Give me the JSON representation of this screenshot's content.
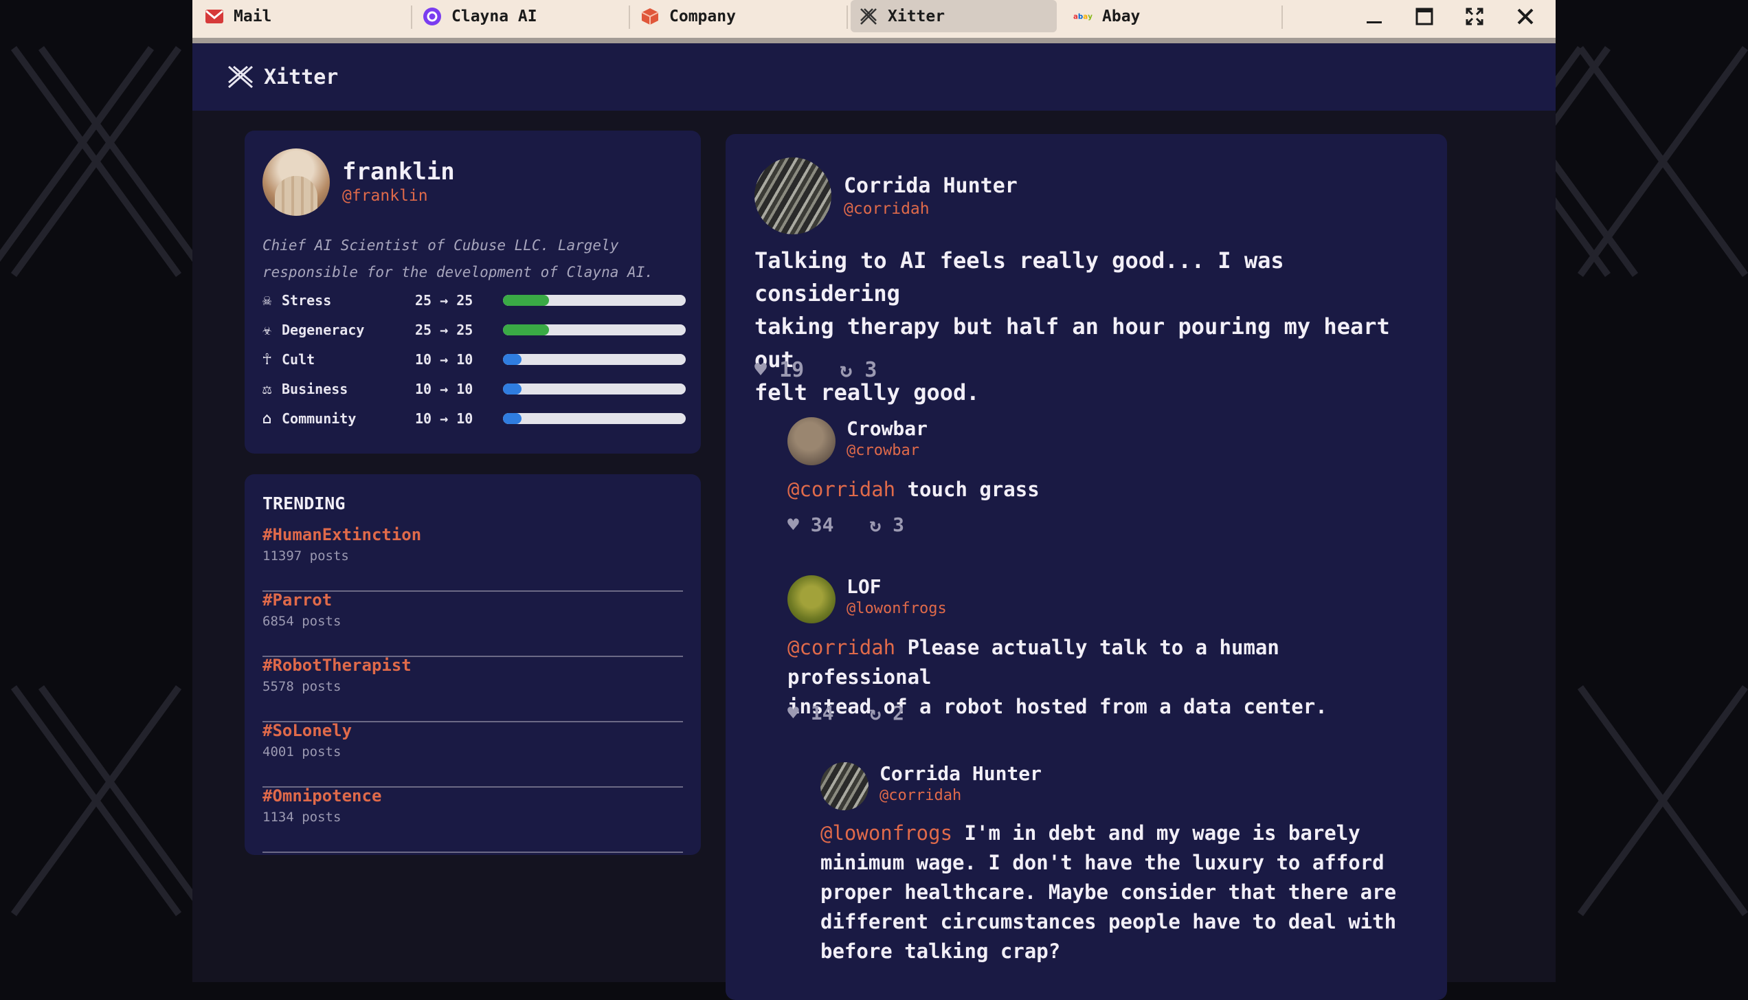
{
  "tabs": [
    {
      "label": "Mail",
      "icon": "mail-icon"
    },
    {
      "label": "Clayna AI",
      "icon": "clayna-icon"
    },
    {
      "label": "Company",
      "icon": "company-icon"
    },
    {
      "label": "Xitter",
      "icon": "xitter-icon"
    },
    {
      "label": "Abay",
      "icon": "abay-icon"
    }
  ],
  "app": {
    "title": "Xitter"
  },
  "profile": {
    "name": "franklin",
    "handle": "@franklin",
    "bio": "Chief AI Scientist of Cubuse LLC. Largely responsible for the development of Clayna AI.",
    "stats": [
      {
        "icon": "☠",
        "label": "Stress",
        "value": "25 → 25",
        "level": 0.25,
        "color": "#3aaa45"
      },
      {
        "icon": "☣",
        "label": "Degeneracy",
        "value": "25 → 25",
        "level": 0.25,
        "color": "#3aaa45"
      },
      {
        "icon": "☥",
        "label": "Cult",
        "value": "10 → 10",
        "level": 0.1,
        "color": "#2f7de0"
      },
      {
        "icon": "⚖",
        "label": "Business",
        "value": "10 → 10",
        "level": 0.1,
        "color": "#2f7de0"
      },
      {
        "icon": "⌂",
        "label": "Community",
        "value": "10 → 10",
        "level": 0.1,
        "color": "#2f7de0"
      }
    ]
  },
  "trending": {
    "title": "TRENDING",
    "items": [
      {
        "tag": "#HumanExtinction",
        "count": "11397 posts"
      },
      {
        "tag": "#Parrot",
        "count": "6854 posts"
      },
      {
        "tag": "#RobotTherapist",
        "count": "5578 posts"
      },
      {
        "tag": "#SoLonely",
        "count": "4001 posts"
      },
      {
        "tag": "#Omnipotence",
        "count": "1134 posts"
      }
    ]
  },
  "feed": {
    "main": {
      "name": "Corrida Hunter",
      "handle": "@corridah",
      "text_lines": [
        "Talking to AI feels really good... I was considering",
        "taking therapy but half an hour pouring my heart out",
        "felt really good."
      ],
      "likes": "19",
      "reposts": "3"
    },
    "reply1": {
      "name": "Crowbar",
      "handle": "@crowbar",
      "mention": "@corridah",
      "text": " touch grass",
      "likes": "34",
      "reposts": "3"
    },
    "reply2": {
      "name": "LOF",
      "handle": "@lowonfrogs",
      "mention": "@corridah",
      "text_line1": " Please actually talk to a human professional",
      "text_line2": "instead of a robot hosted from a data center.",
      "likes": "14",
      "reposts": "2"
    },
    "reply3": {
      "name": "Corrida Hunter",
      "handle": "@corridah",
      "mention": "@lowonfrogs",
      "text_line1": " I'm in debt and my wage is barely",
      "text_lines": [
        "minimum wage. I don't have the luxury to afford",
        "proper healthcare. Maybe consider that there are",
        "different circumstances people have to deal with",
        "before talking crap?"
      ]
    }
  }
}
